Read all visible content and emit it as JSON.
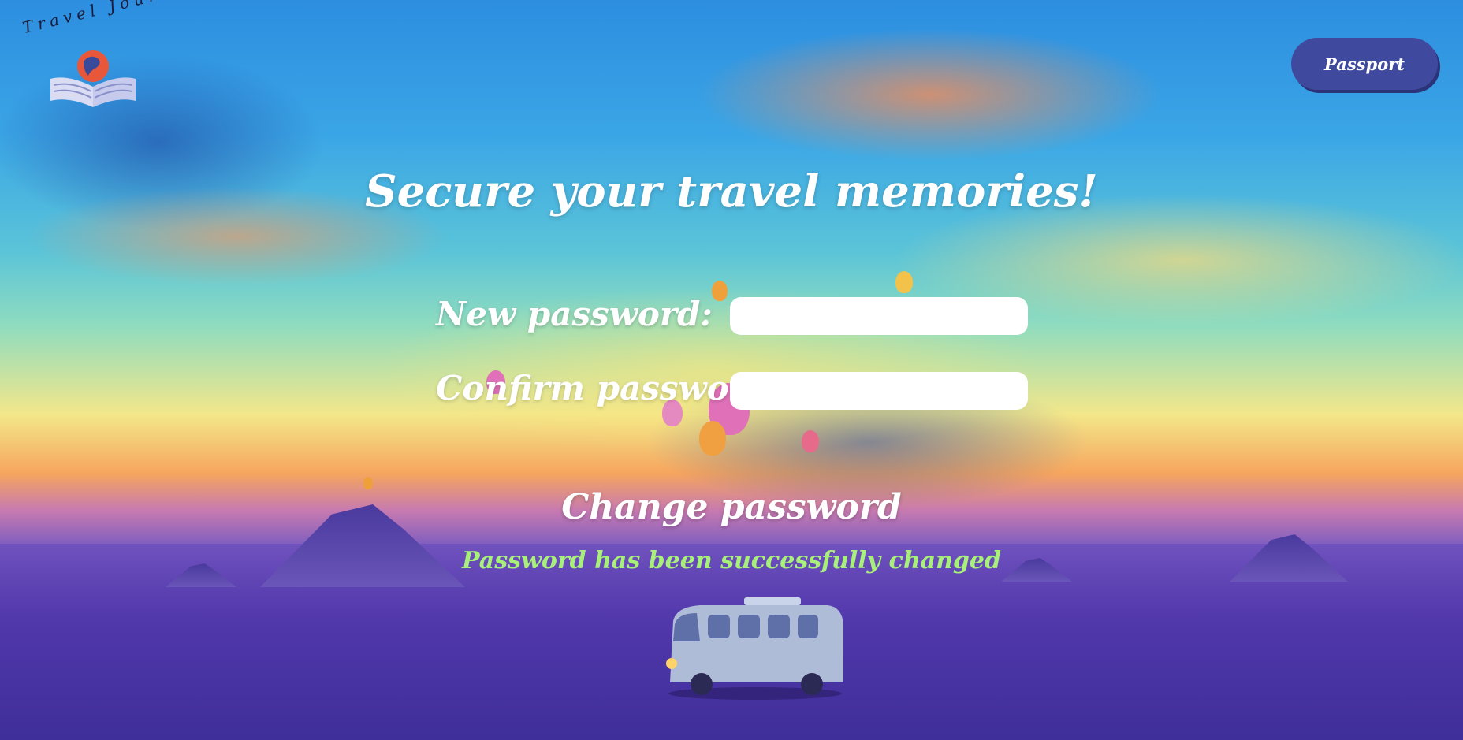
{
  "logo": {
    "text": "Travel Journal"
  },
  "header": {
    "passport_label": "Passport"
  },
  "main": {
    "title": "Secure your travel memories!",
    "new_password_label": "New password:",
    "confirm_password_label": "Confirm password:",
    "new_password_value": "",
    "confirm_password_value": "",
    "change_button_label": "Change password",
    "success_message": "Password has been successfully changed"
  },
  "colors": {
    "button_bg": "#3f4a9e",
    "success_text": "#a8f07a",
    "text": "#ffffff"
  }
}
